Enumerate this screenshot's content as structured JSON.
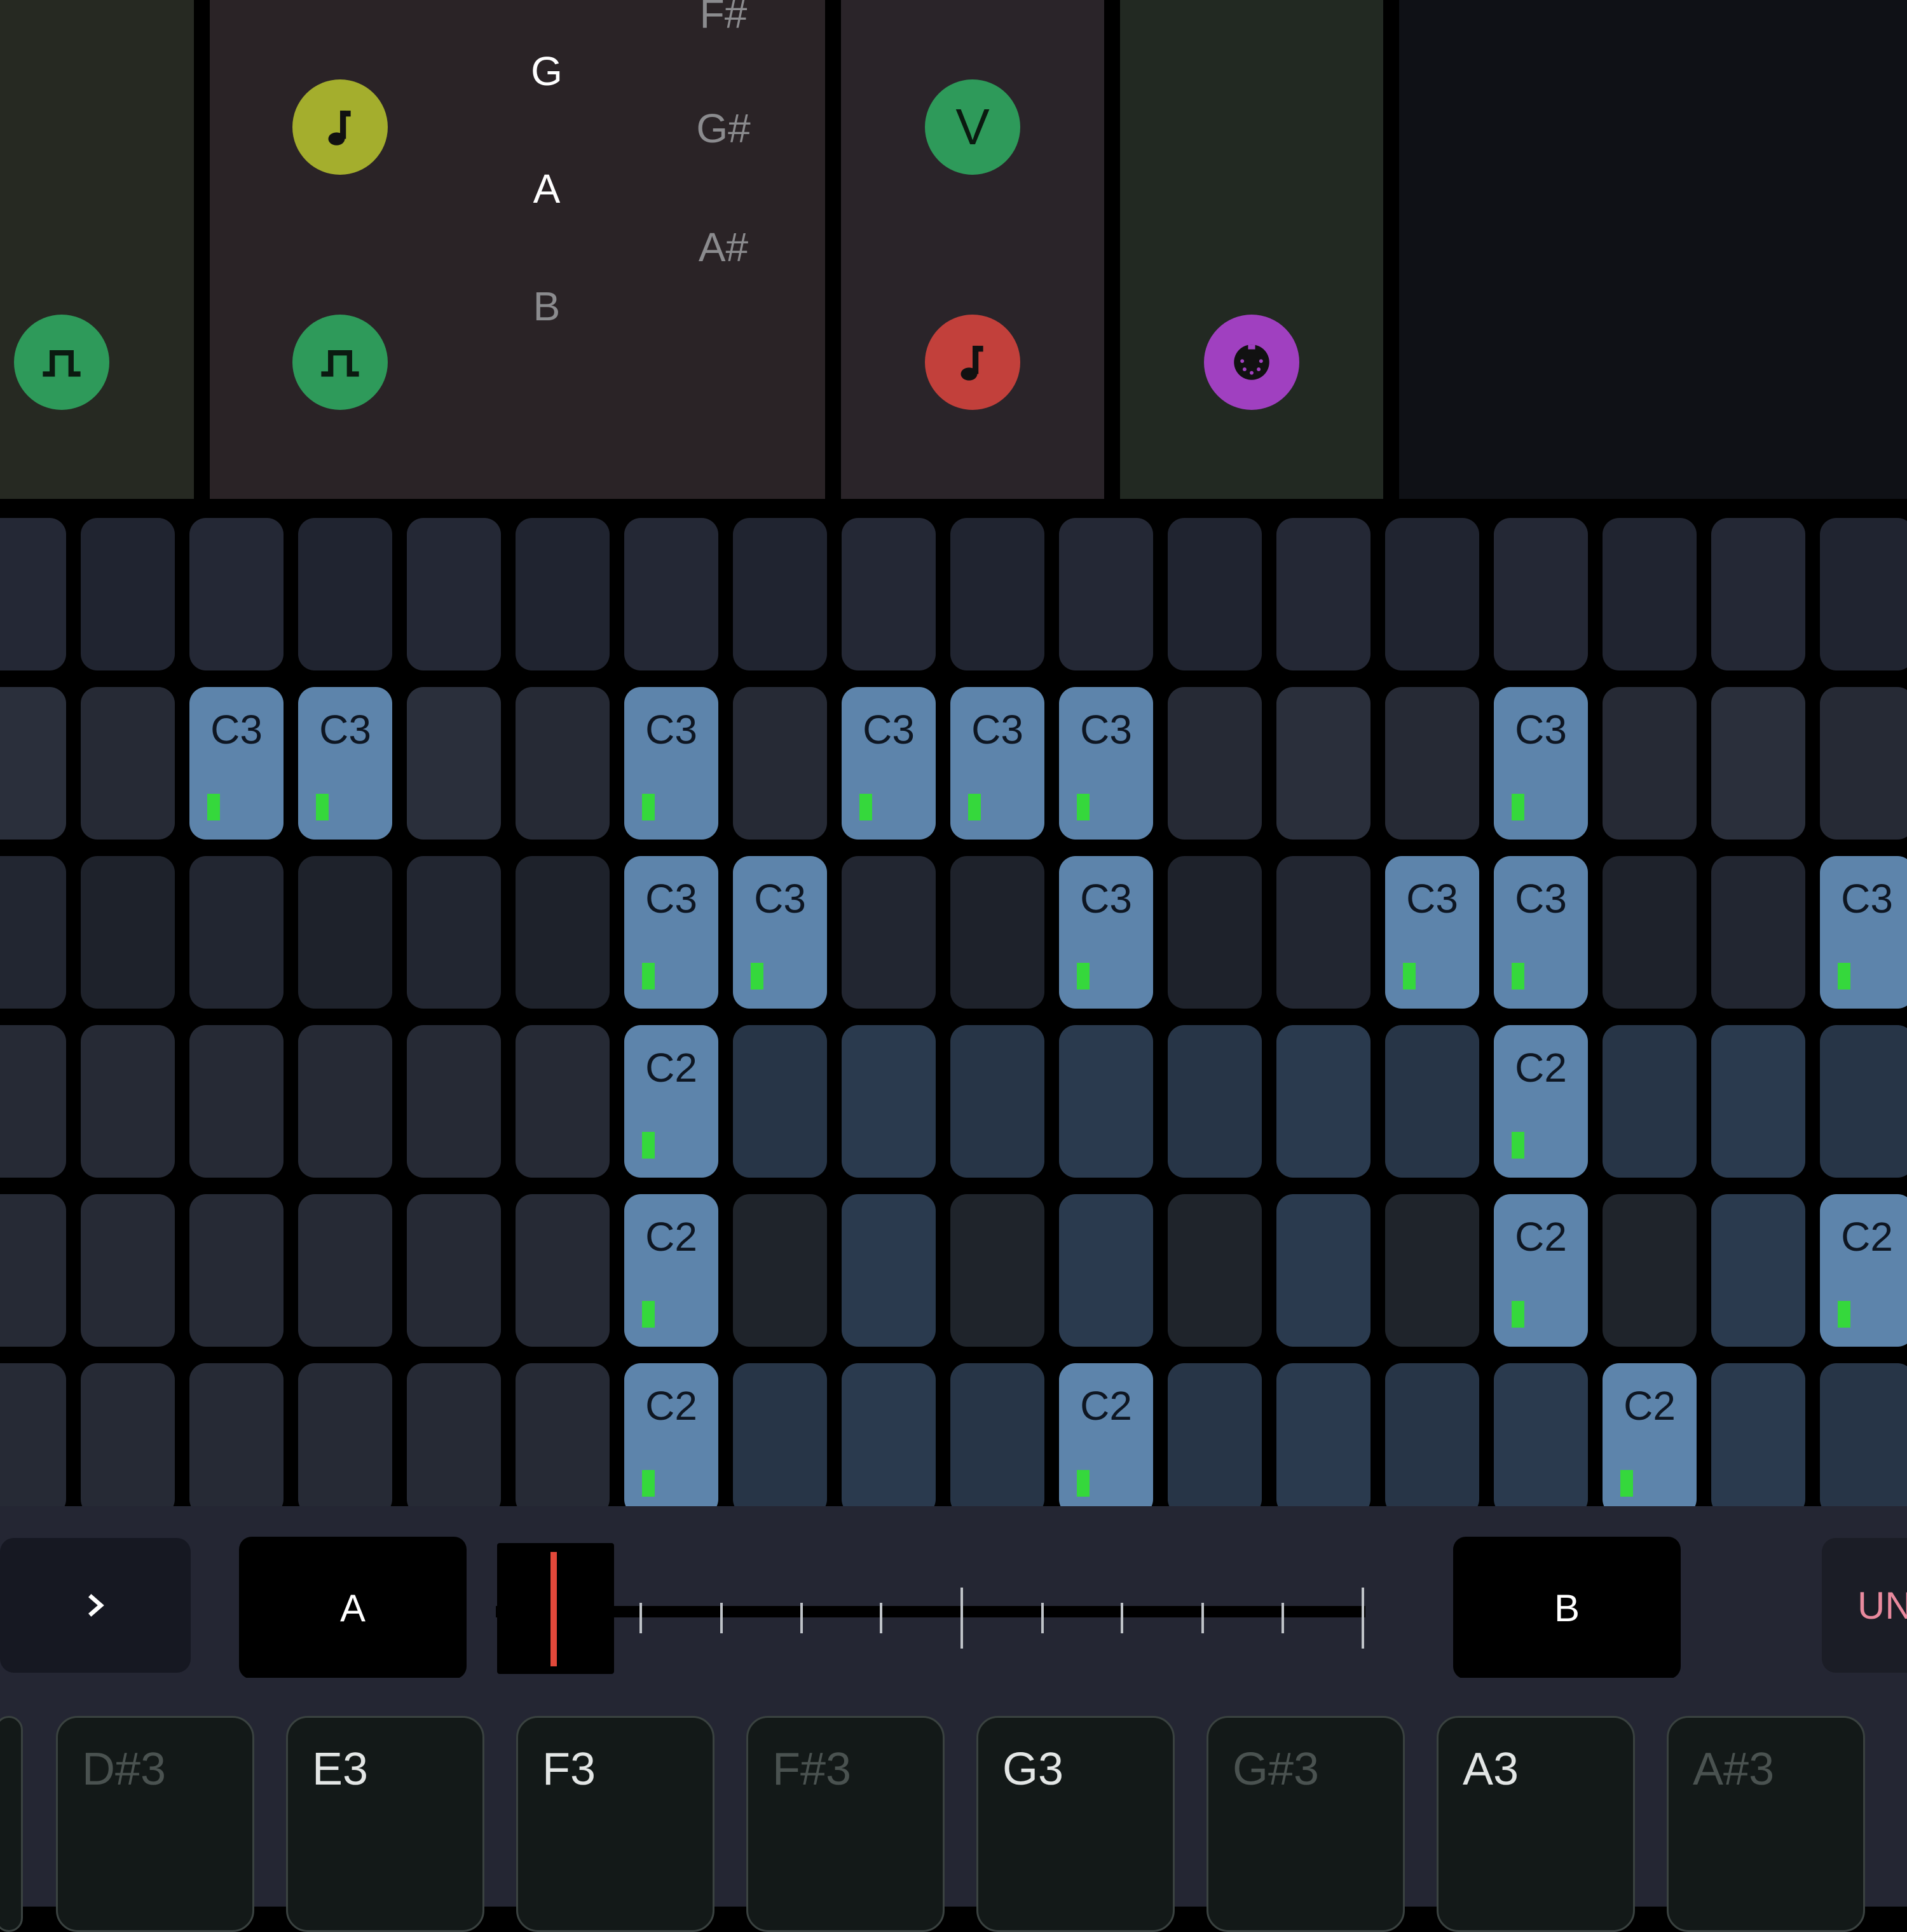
{
  "panels": {
    "tempo": {
      "chip": "square-wave-icon"
    },
    "scale": {
      "chips": [
        "note-icon",
        "square-wave-icon"
      ],
      "natural_notes": [
        "G",
        "A",
        "B"
      ],
      "sharp_notes": [
        "F#",
        "G#",
        "A#"
      ],
      "active_natural": [
        "G",
        "A"
      ]
    },
    "voice": {
      "chip_top_label": "V",
      "chip_bottom": "note-icon"
    },
    "midi": {
      "chip": "midi-port-icon"
    }
  },
  "grid": {
    "rows": [
      {
        "id": "row-1",
        "cells": [
          "",
          "",
          "",
          "",
          "",
          "",
          "",
          "",
          "",
          "",
          "",
          "",
          "",
          "",
          "",
          "",
          "",
          ""
        ]
      },
      {
        "id": "row-2",
        "cells": [
          "",
          "",
          "C3",
          "C3",
          "",
          "",
          "C3",
          "",
          "C3",
          "C3",
          "C3",
          "",
          "",
          "",
          "C3",
          "",
          "",
          ""
        ]
      },
      {
        "id": "row-3",
        "cells": [
          "",
          "",
          "",
          "",
          "",
          "",
          "C3",
          "C3",
          "",
          "",
          "C3",
          "",
          "",
          "C3",
          "C3",
          "",
          "",
          "C3"
        ]
      },
      {
        "id": "row-4",
        "cells": [
          "",
          "",
          "",
          "",
          "",
          "",
          "C2",
          "",
          "",
          "",
          "",
          "",
          "",
          "",
          "C2",
          "",
          "",
          ""
        ]
      },
      {
        "id": "row-5",
        "cells": [
          "",
          "",
          "",
          "",
          "",
          "",
          "C2",
          "",
          "",
          "",
          "",
          "",
          "",
          "",
          "C2",
          "",
          "",
          "C2"
        ]
      },
      {
        "id": "row-6",
        "cells": [
          "",
          "",
          "",
          "",
          "",
          "",
          "C2",
          "",
          "",
          "",
          "C2",
          "",
          "",
          "",
          "",
          "C2",
          "",
          ""
        ]
      }
    ]
  },
  "transport": {
    "expand_label": ">",
    "a_label": "A",
    "b_label": "B",
    "undo_label": "UN"
  },
  "keyboard": {
    "keys": [
      {
        "label": "D#3",
        "sharp": true
      },
      {
        "label": "E3",
        "sharp": false
      },
      {
        "label": "F3",
        "sharp": false
      },
      {
        "label": "F#3",
        "sharp": true
      },
      {
        "label": "G3",
        "sharp": false
      },
      {
        "label": "G#3",
        "sharp": true
      },
      {
        "label": "A3",
        "sharp": false
      },
      {
        "label": "A#3",
        "sharp": true
      }
    ]
  },
  "colors": {
    "active_cell": "#5d84ab",
    "velocity": "#35d83c",
    "playhead": "#e2483a",
    "chip_green": "#2e9a5a",
    "chip_olive": "#a4ae2d",
    "chip_red": "#c2403b",
    "chip_purple": "#a040c0"
  }
}
